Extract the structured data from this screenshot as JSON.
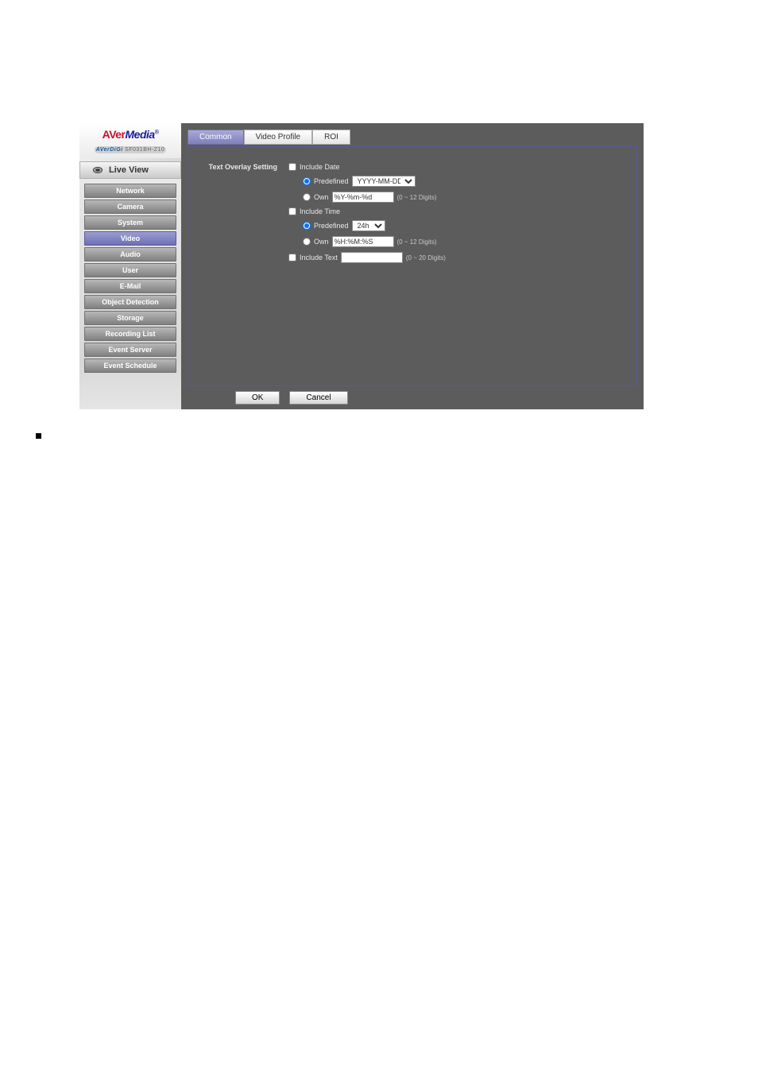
{
  "brand": {
    "name_part1": "AVer",
    "name_part2": "Media",
    "superscript": "®",
    "sub_prefix": "AVerDiGi",
    "sub_model": " SF031BH-Z10"
  },
  "sidebar": {
    "live_view": "Live View",
    "items": [
      "Network",
      "Camera",
      "System",
      "Video",
      "Audio",
      "User",
      "E-Mail",
      "Object Detection",
      "Storage",
      "Recording List",
      "Event Server",
      "Event Schedule"
    ],
    "active_index": 3
  },
  "tabs": {
    "items": [
      "Common",
      "Video Profile",
      "ROI"
    ],
    "active_index": 0
  },
  "settings": {
    "section_label": "Text Overlay Setting",
    "include_date": {
      "label": "Include Date",
      "predefined_label": "Predefined",
      "predefined_value": "YYYY-MM-DD",
      "own_label": "Own",
      "own_value": "%Y-%m-%d",
      "hint": "(0 ~ 12 Digits)"
    },
    "include_time": {
      "label": "Include Time",
      "predefined_label": "Predefined",
      "predefined_value": "24h",
      "own_label": "Own",
      "own_value": "%H:%M:%S",
      "hint": "(0 ~ 12 Digits)"
    },
    "include_text": {
      "label": "Include Text",
      "value": "",
      "hint": "(0 ~ 20 Digits)"
    }
  },
  "buttons": {
    "ok": "OK",
    "cancel": "Cancel"
  }
}
